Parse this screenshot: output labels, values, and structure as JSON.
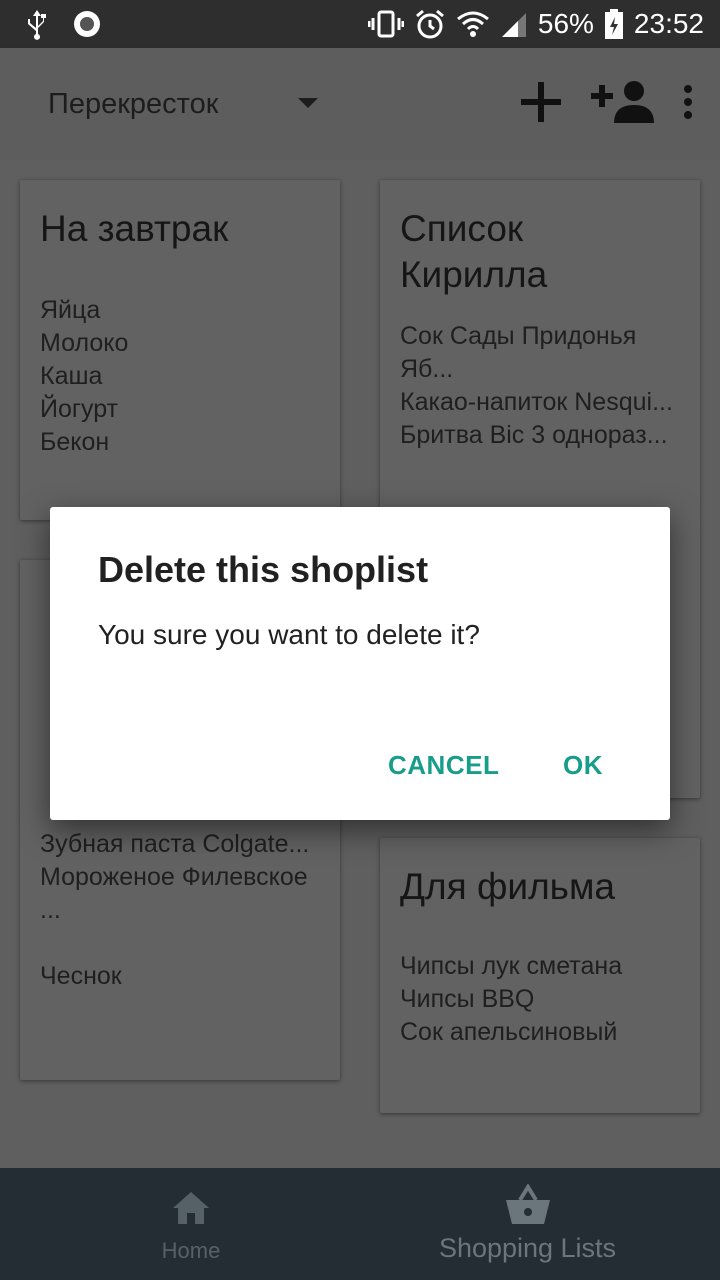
{
  "status_bar": {
    "battery": "56%",
    "time": "23:52"
  },
  "app_bar": {
    "store_selected": "Перекресток"
  },
  "cards": [
    {
      "title": "На завтрак",
      "items": [
        "Яйца",
        "Молоко",
        "Каша",
        "Йогурт",
        "Бекон"
      ]
    },
    {
      "title": "Список Кирилла",
      "items": [
        "Сок Сады Придонья Яб...",
        "Какао-напиток Nesqui...",
        "Бритва Bic 3 однораз..."
      ]
    },
    {
      "title": "",
      "items": [
        "Зубная паста Colgate...",
        "Мороженое Филевское ...",
        "",
        "Чеснок"
      ]
    },
    {
      "title": "Для фильма",
      "items": [
        "Чипсы лук сметана",
        "Чипсы BBQ",
        "Сок апельсиновый"
      ]
    }
  ],
  "dialog": {
    "title": "Delete this shoplist",
    "message": "You sure you want to delete it?",
    "cancel_label": "CANCEL",
    "ok_label": "OK"
  },
  "bottom_nav": {
    "items": [
      {
        "label": "Home",
        "icon": "home-icon"
      },
      {
        "label": "Shopping Lists",
        "icon": "basket-icon"
      }
    ]
  },
  "colors": {
    "accent": "#179d8a",
    "nav_background": "#242d33",
    "status_bar": "#2e2e2e"
  }
}
